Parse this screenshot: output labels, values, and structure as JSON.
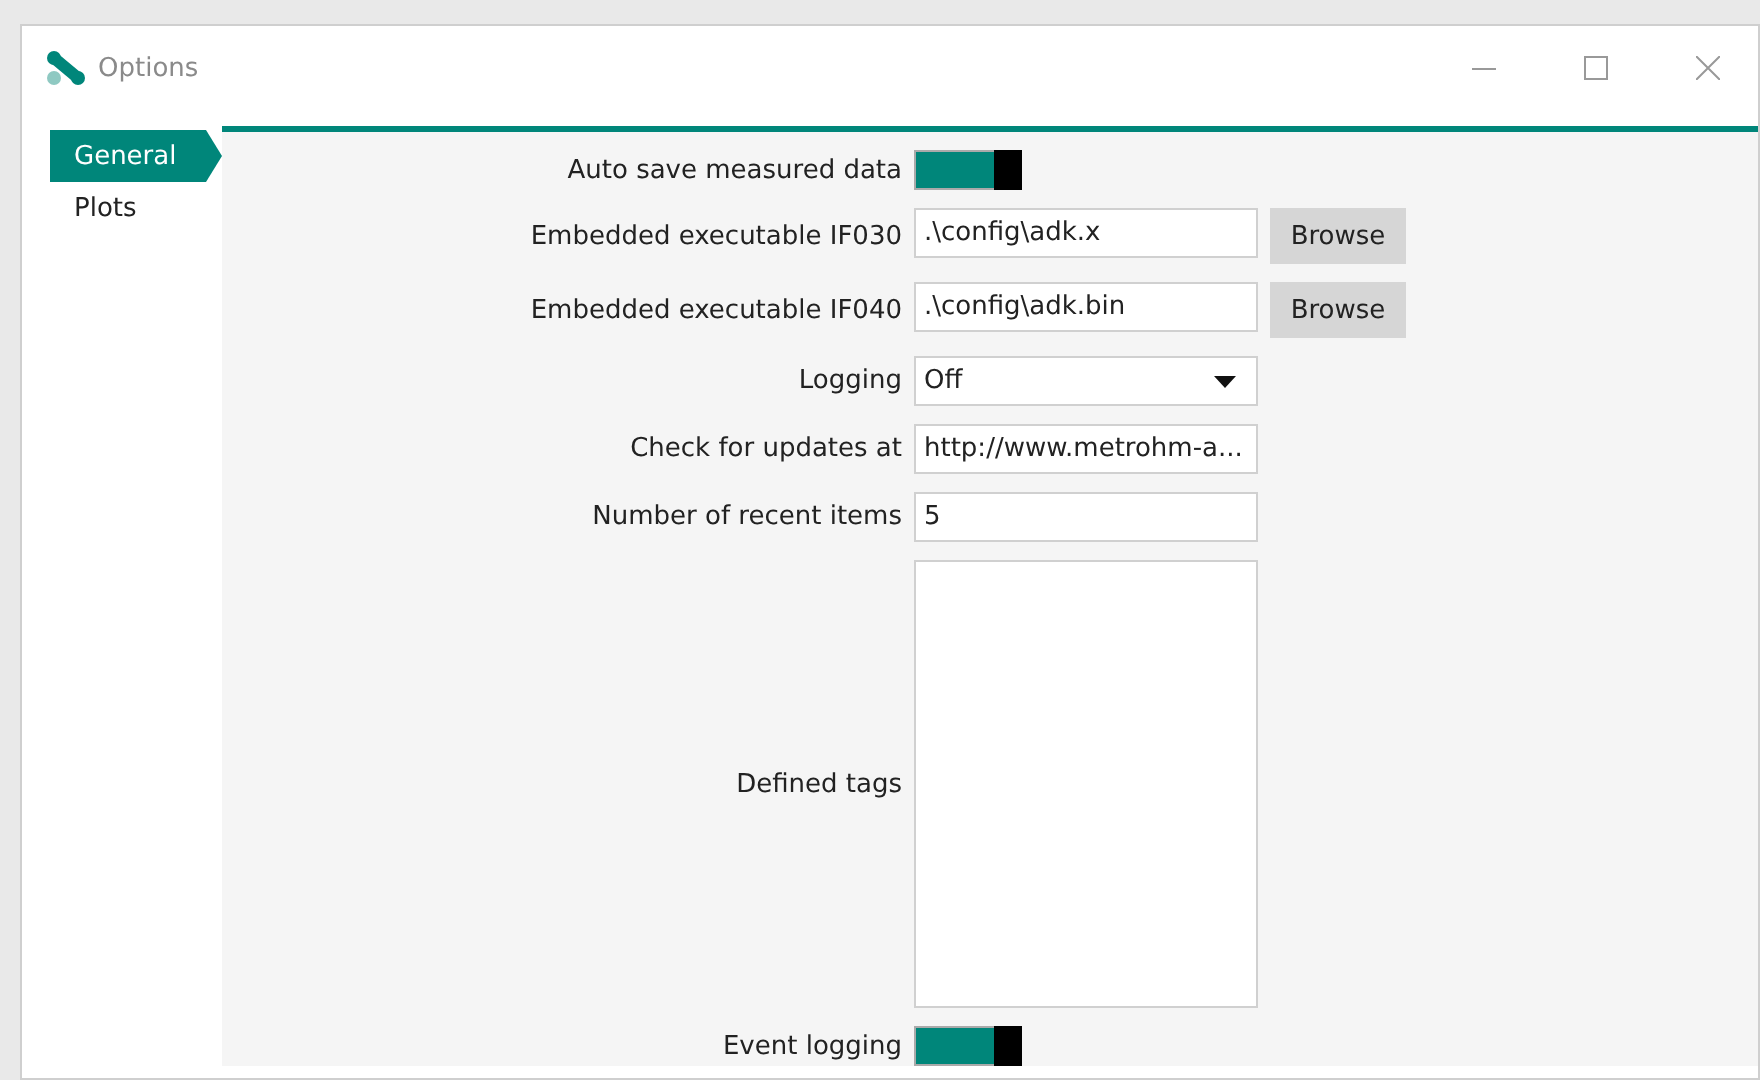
{
  "window": {
    "title": "Options"
  },
  "sidebar": {
    "items": [
      {
        "label": "General",
        "selected": true
      },
      {
        "label": "Plots",
        "selected": false
      }
    ]
  },
  "fields": [
    {
      "kind": "toggle",
      "label": "Auto save measured data",
      "on": true
    },
    {
      "kind": "path",
      "label": "Embedded executable IF030",
      "value": ".\\config\\adk.x",
      "button": "Browse"
    },
    {
      "kind": "path",
      "label": "Embedded executable IF040",
      "value": ".\\config\\adk.bin",
      "button": "Browse"
    },
    {
      "kind": "dropdown",
      "label": "Logging",
      "value": "Off"
    },
    {
      "kind": "text",
      "label": "Check for updates at",
      "value": "http://www.metrohm-a..."
    },
    {
      "kind": "text",
      "label": "Number of recent items",
      "value": "5"
    },
    {
      "kind": "textarea",
      "label": "Defined tags"
    },
    {
      "kind": "toggle",
      "label": "Event logging",
      "on": true
    }
  ]
}
